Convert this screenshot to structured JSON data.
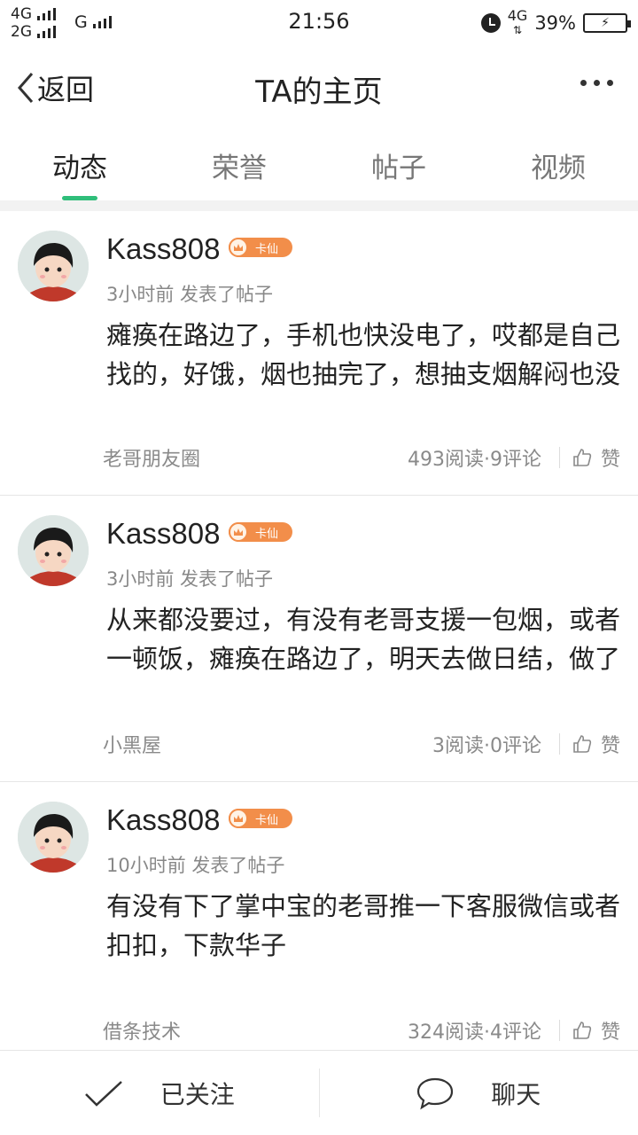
{
  "status_bar": {
    "net_line1": "4G",
    "net_line2": "2G",
    "net_g": "G",
    "time": "21:56",
    "net_right": "4G",
    "battery_pct": "39%"
  },
  "header": {
    "back_label": "返回",
    "title": "TA的主页"
  },
  "tabs": [
    {
      "label": "动态"
    },
    {
      "label": "荣誉"
    },
    {
      "label": "帖子"
    },
    {
      "label": "视频"
    }
  ],
  "posts": [
    {
      "username": "Kass808",
      "badge": "卡仙",
      "meta": "3小时前  发表了帖子",
      "content": "瘫痪在路边了，手机也快没电了，哎都是自己找的，好饿，烟也抽完了，想抽支烟解闷也没",
      "group": "老哥朋友圈",
      "stats": "493阅读·9评论",
      "like_label": "赞"
    },
    {
      "username": "Kass808",
      "badge": "卡仙",
      "meta": "3小时前  发表了帖子",
      "content": "从来都没要过，有没有老哥支援一包烟，或者一顿饭，瘫痪在路边了，明天去做日结，做了",
      "group": "小黑屋",
      "stats": "3阅读·0评论",
      "like_label": "赞"
    },
    {
      "username": "Kass808",
      "badge": "卡仙",
      "meta": "10小时前  发表了帖子",
      "content": "有没有下了掌中宝的老哥推一下客服微信或者扣扣，下款华子",
      "group": "借条技术",
      "stats": "324阅读·4评论",
      "like_label": "赞"
    }
  ],
  "bottom_bar": {
    "follow_label": "已关注",
    "chat_label": "聊天"
  },
  "colors": {
    "accent": "#2fbe7a",
    "badge": "#f28e4a"
  }
}
